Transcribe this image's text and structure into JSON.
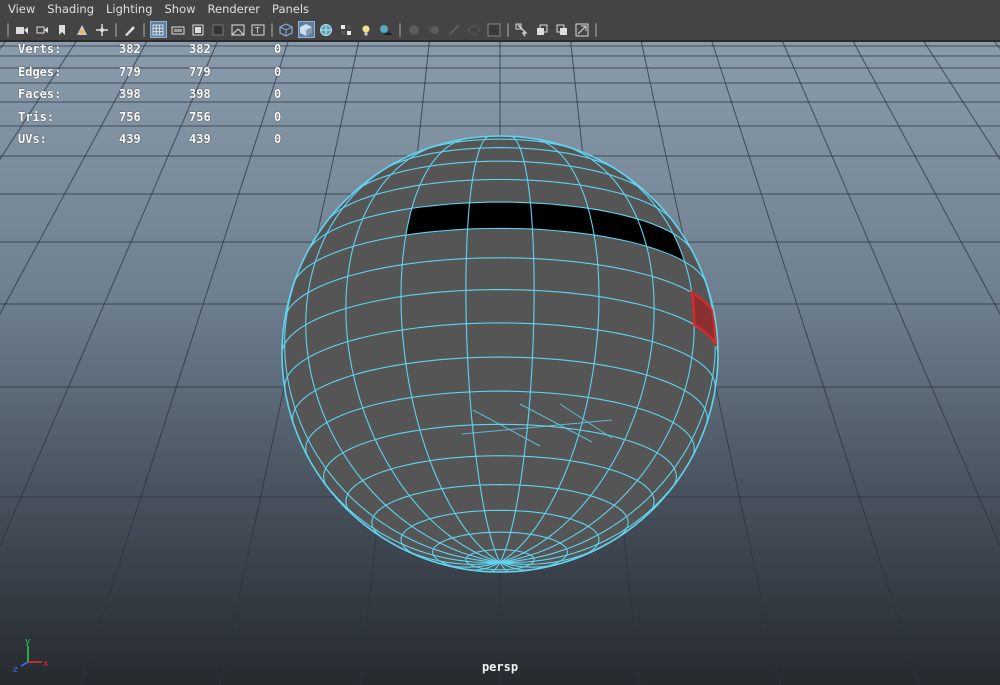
{
  "menu": [
    "View",
    "Shading",
    "Lighting",
    "Show",
    "Renderer",
    "Panels"
  ],
  "toolbar": {
    "icons": [
      "camera-icon",
      "camera-attributes-icon",
      "bookmark-icon",
      "image-plane-icon",
      "pan-zoom-icon",
      "grease-pencil-icon",
      "grid-icon",
      "film-gate-icon",
      "resolution-gate-icon",
      "gate-mask-icon",
      "field-chart-icon",
      "safe-action-icon",
      "wireframe-icon",
      "smooth-shade-icon",
      "wireframe-on-shaded-icon",
      "textured-icon",
      "use-all-lights-icon",
      "shadows-icon",
      "screen-space-ambient-occlusion-icon",
      "motion-blur-icon",
      "anti-aliasing-icon",
      "depth-of-field-icon",
      "isolate-select-icon",
      "xray-icon",
      "xray-active-components-icon",
      "xray-joints-icon",
      "backface-culling-icon"
    ]
  },
  "hud": {
    "rows": [
      {
        "label": "Verts:",
        "c1": "382",
        "c2": "382",
        "c3": "0"
      },
      {
        "label": "Edges:",
        "c1": "779",
        "c2": "779",
        "c3": "0"
      },
      {
        "label": "Faces:",
        "c1": "398",
        "c2": "398",
        "c3": "0"
      },
      {
        "label": "Tris:",
        "c1": "756",
        "c2": "756",
        "c3": "0"
      },
      {
        "label": "UVs:",
        "c1": "439",
        "c2": "439",
        "c3": "0"
      }
    ]
  },
  "camera": {
    "name": "persp"
  },
  "axis": {
    "y": "y",
    "x": "x",
    "z": "z"
  },
  "colors": {
    "wire": "#5fd3f0",
    "selected_face": "#d42a2a",
    "sphere_shade": "#555555",
    "grid": "#2a3440"
  }
}
